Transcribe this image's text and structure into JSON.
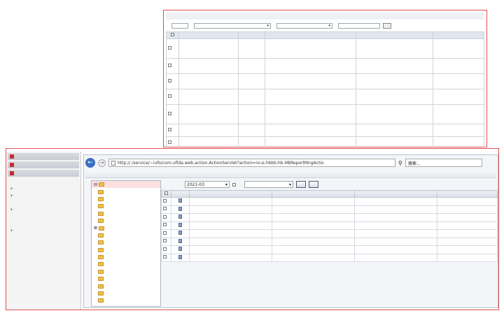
{
  "top_window": {
    "menu": [
      "",
      "",
      "",
      "",
      "",
      "",
      "",
      "",
      ""
    ],
    "filter": {
      "label1": "",
      "value1": "",
      "label2": "",
      "value2": "",
      "label3": "",
      "value3": "",
      "label4": "",
      "value4": "",
      "button": ""
    },
    "columns": [
      "",
      "",
      "",
      "",
      "",
      ""
    ],
    "rows": [
      {
        "code": "",
        "type": "",
        "desc": "",
        "formula": "",
        "note": ""
      },
      {
        "code": "",
        "type": "",
        "desc": "",
        "formula": "",
        "note": ""
      },
      {
        "code": "",
        "type": "",
        "desc": "",
        "formula": "",
        "note": ""
      },
      {
        "code": "",
        "type": "",
        "desc": "",
        "formula": "",
        "note": ""
      },
      {
        "code": "",
        "type": "",
        "desc": "",
        "formula": "",
        "note": ""
      },
      {
        "code": "",
        "type": "",
        "desc": "",
        "formula": "",
        "note": ""
      },
      {
        "code": "",
        "type": "",
        "desc": "",
        "formula": "",
        "note": ""
      }
    ]
  },
  "left_nav": {
    "headers": [
      "",
      "",
      ""
    ],
    "items": [
      "",
      "",
      "",
      "",
      "",
      "",
      "",
      "",
      ""
    ]
  },
  "browser": {
    "url": "http://  /service/~iufo/com.ufida.web.action.ActionServlet?action=ncui.hbbb.hb.HBReportMngActio",
    "search_placeholder": "搜索...",
    "toolbar": [
      "",
      "",
      "",
      "",
      "",
      "",
      "",
      "",
      "",
      ""
    ],
    "filter": {
      "period_label": "",
      "period_value": "2021-03",
      "sub_label": "",
      "status_label": "",
      "status_value": "",
      "query_button": "",
      "advanced_button": ""
    },
    "tree_items": [
      "",
      "",
      "",
      "",
      "",
      "",
      "",
      "",
      "",
      "",
      "",
      "",
      "",
      "",
      "",
      "",
      ""
    ],
    "grid_columns": [
      "",
      "",
      "",
      "",
      ""
    ],
    "grid_rows": [
      {
        "report": "",
        "unit": "",
        "name": "",
        "status": ""
      },
      {
        "report": "",
        "unit": "",
        "name": "",
        "status": ""
      },
      {
        "report": "",
        "unit": "",
        "name": "",
        "status": ""
      },
      {
        "report": "",
        "unit": "",
        "name": "",
        "status": ""
      },
      {
        "report": "",
        "unit": "",
        "name": "",
        "status": ""
      },
      {
        "report": "",
        "unit": "",
        "name": "",
        "status": ""
      },
      {
        "report": "",
        "unit": "",
        "name": "",
        "status": ""
      },
      {
        "report": "",
        "unit": "",
        "name": "",
        "status": ""
      }
    ]
  }
}
